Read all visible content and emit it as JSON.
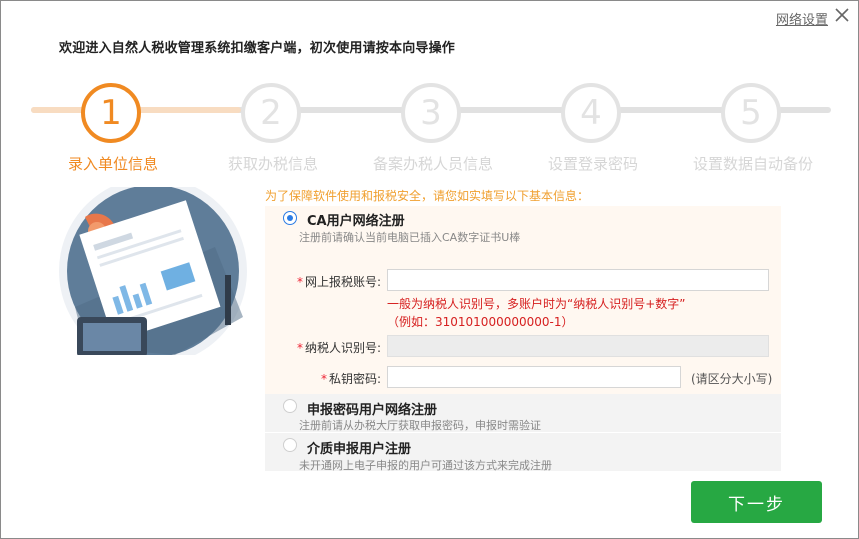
{
  "window": {
    "title": "欢迎进入自然人税收管理系统扣缴客户端，初次使用请按本向导操作",
    "net_settings_label": "网络设置",
    "close_icon": "close-icon"
  },
  "steps": [
    {
      "num": "1",
      "label": "录入单位信息",
      "active": true
    },
    {
      "num": "2",
      "label": "获取办税信息",
      "active": false
    },
    {
      "num": "3",
      "label": "备案办税人员信息",
      "active": false
    },
    {
      "num": "4",
      "label": "设置登录密码",
      "active": false
    },
    {
      "num": "5",
      "label": "设置数据自动备份",
      "active": false
    }
  ],
  "form": {
    "hint": "为了保障软件使用和报税安全，请您如实填写以下基本信息：",
    "options": [
      {
        "title": "CA用户网络注册",
        "desc": "注册前请确认当前电脑已插入CA数字证书U棒",
        "checked": true
      },
      {
        "title": "申报密码用户网络注册",
        "desc": "注册前请从办税大厅获取申报密码，申报时需验证",
        "checked": false
      },
      {
        "title": "介质申报用户注册",
        "desc": "未开通网上电子申报的用户可通过该方式来完成注册",
        "checked": false
      }
    ],
    "fields": {
      "account": {
        "required_mark": "*",
        "label": "网上报税账号:",
        "value": ""
      },
      "account_note_line1": "一般为纳税人识别号，多账户时为“纳税人识别号+数字”",
      "account_note_line2": "（例如：310101000000000-1）",
      "taxpayer_id": {
        "required_mark": "*",
        "label": "纳税人识别号:",
        "value": ""
      },
      "private_key": {
        "required_mark": "*",
        "label": "私钥密码:",
        "value": ""
      },
      "case_hint": "(请区分大小写)"
    }
  },
  "buttons": {
    "next_label": "下一步"
  },
  "colors": {
    "accent_orange": "#f08a22",
    "inactive_gray": "#e3e3e3",
    "next_green": "#27a843",
    "radio_blue": "#2a7be4",
    "note_red": "#d62020"
  }
}
